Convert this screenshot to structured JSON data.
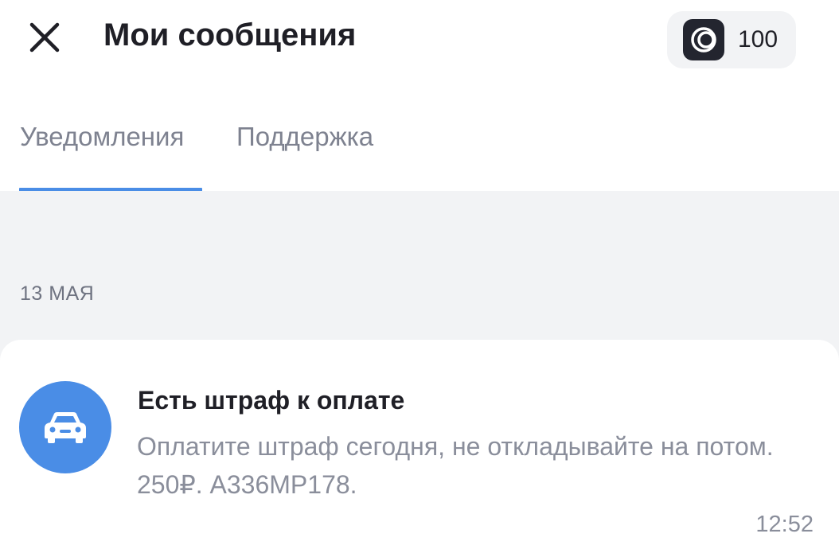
{
  "header": {
    "title": "Мои сообщения",
    "close_icon": "close-icon",
    "coins": {
      "icon": "coin-rings-icon",
      "value": "100"
    }
  },
  "tabs": [
    {
      "label": "Уведомления",
      "active": true
    },
    {
      "label": "Поддержка",
      "active": false
    }
  ],
  "colors": {
    "accent": "#4a8de6",
    "background_gray": "#f2f3f5",
    "title_text": "#1f1f26",
    "secondary_text": "#8a8e9b"
  },
  "feed": {
    "date_label": "13 МАЯ",
    "notifications": [
      {
        "icon": "car-icon",
        "title": "Есть штраф к оплате",
        "body": "Оплатите штраф сегодня, не откладывайте на потом. 250₽. А336МР178.",
        "time": "12:52"
      }
    ]
  }
}
